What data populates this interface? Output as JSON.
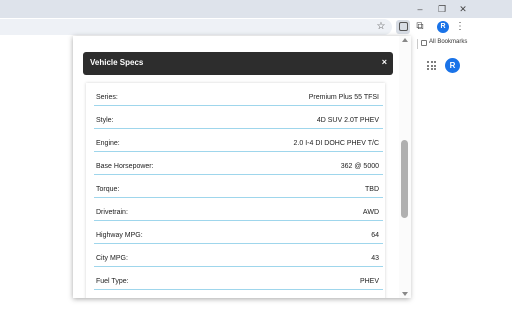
{
  "window": {
    "minimize_icon": "minimize-icon",
    "maximize_icon": "maximize-icon",
    "close_icon": "close-icon",
    "minimize_glyph": "–",
    "maximize_glyph": "❐",
    "close_glyph": "✕"
  },
  "toolbar": {
    "star_glyph": "☆",
    "puzzle_glyph": "⧉",
    "profile_initial": "R",
    "menu_glyph": "⋮"
  },
  "bookmarks": {
    "all_bookmarks_label": "All Bookmarks"
  },
  "page": {
    "avatar_initial": "R"
  },
  "popup": {
    "title": "Vehicle Specs",
    "close_glyph": "×",
    "header_color": "#2d2d2d",
    "divider_color": "#9fd6ec"
  },
  "specs": [
    {
      "label": "Series:",
      "value": "Premium Plus 55 TFSI"
    },
    {
      "label": "Style:",
      "value": "4D SUV 2.0T PHEV"
    },
    {
      "label": "Engine:",
      "value": "2.0 I-4 DI DOHC PHEV T/C"
    },
    {
      "label": "Base Horsepower:",
      "value": "362 @ 5000"
    },
    {
      "label": "Torque:",
      "value": "TBD"
    },
    {
      "label": "Drivetrain:",
      "value": "AWD"
    },
    {
      "label": "Highway MPG:",
      "value": "64"
    },
    {
      "label": "City MPG:",
      "value": "43"
    },
    {
      "label": "Fuel Type:",
      "value": "PHEV"
    }
  ]
}
